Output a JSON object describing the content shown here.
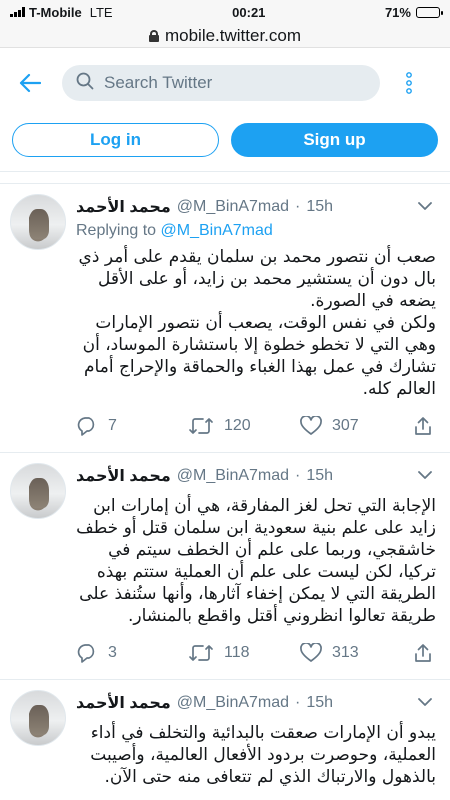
{
  "status_bar": {
    "carrier": "T-Mobile",
    "network": "LTE",
    "time": "00:21",
    "battery_percent": "71%",
    "battery_level": 0.71
  },
  "url_bar": {
    "url": "mobile.twitter.com"
  },
  "header": {
    "search_placeholder": "Search Twitter"
  },
  "auth": {
    "login_label": "Log in",
    "signup_label": "Sign up"
  },
  "colors": {
    "brand": "#1da1f2",
    "muted": "#657786",
    "text": "#14171a"
  },
  "tweets": [
    {
      "name": "محمد الأحمد",
      "handle": "@M_BinA7mad",
      "separator": "·",
      "time": "15h",
      "replying_prefix": "Replying to",
      "replying_to": "@M_BinA7mad",
      "text_lines": [
        "صعب أن نتصور محمد بن سلمان يقدم على أمر ذي بال دون أن يستشير محمد بن زايد، أو على الأقل يضعه في الصورة.",
        "ولكن في نفس الوقت، يصعب أن نتصور الإمارات وهي التي لا تخطو خطوة إلا باستشارة الموساد، أن تشارك في عمل بهذا الغباء والحماقة والإحراج أمام العالم كله."
      ],
      "replies": "7",
      "retweets": "120",
      "likes": "307"
    },
    {
      "name": "محمد الأحمد",
      "handle": "@M_BinA7mad",
      "separator": "·",
      "time": "15h",
      "text_lines": [
        "الإجابة التي تحل لغز المفارقة، هي أن إمارات ابن زايد على علم بنية سعودية ابن سلمان قتل أو خطف خاشقجي، وربما على علم أن الخطف سيتم في تركيا، لكن ليست على علم أن العملية ستتم بهذه الطريقة التي لا يمكن إخفاء آثارها، وأنها ستُنفذ على طريقة تعالوا انظروني أقتل واقطع بالمنشار."
      ],
      "replies": "3",
      "retweets": "118",
      "likes": "313"
    },
    {
      "name": "محمد الأحمد",
      "handle": "@M_BinA7mad",
      "separator": "·",
      "time": "15h",
      "text_lines": [
        "يبدو أن الإمارات صعقت بالبدائية والتخلف في أداء العملية، وحوصرت بردود الأفعال العالمية، وأصيبت بالذهول والارتباك الذي لم تتعافى منه حتى الآن."
      ]
    }
  ]
}
